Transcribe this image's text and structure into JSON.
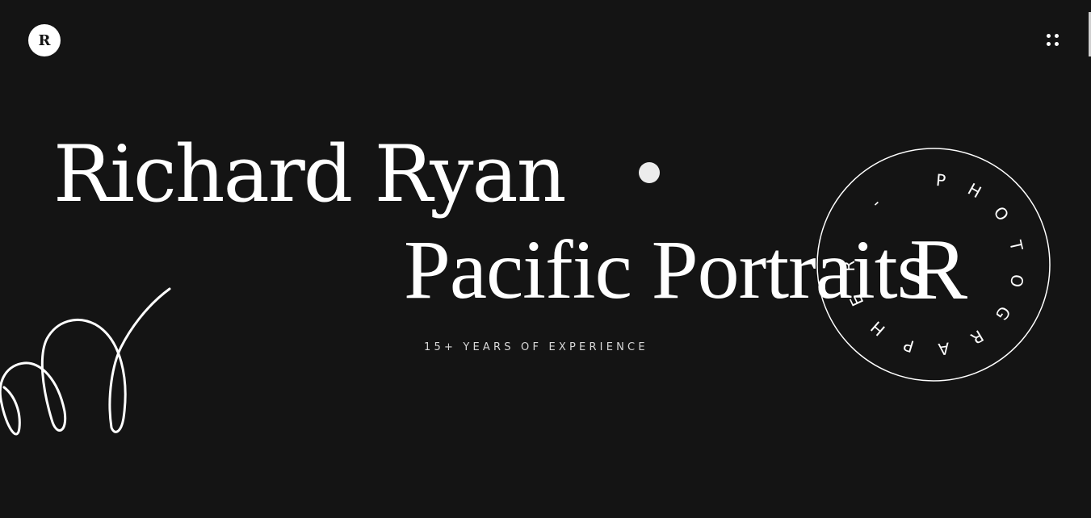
{
  "header": {
    "logo_letter": "R",
    "menu_icon": "dots-grid-icon"
  },
  "hero": {
    "name": "Richard Ryan",
    "subtitle": "Pacific Portraits",
    "tagline": "15+ YEARS OF EXPERIENCE"
  },
  "badge": {
    "monogram": "R",
    "ring_text": "PHOTOGRAPHER - "
  },
  "colors": {
    "background": "#141414",
    "foreground": "#ffffff"
  }
}
